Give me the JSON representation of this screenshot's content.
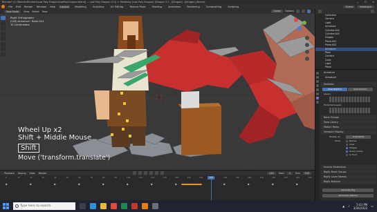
{
  "window": {
    "title": "Blender* [C:\\BlenderRenders\\Low Poly Dragon\\LowPolyDragon.blend]  —  Low Poly Dragon (3.1) > Modeling (Low Poly Dragon) (Dragon 3.1 - [Dragon] - [Dragon] (Blend)",
    "controls": [
      "—",
      "☐",
      "✕"
    ]
  },
  "menubar": {
    "menus": [
      "File",
      "Edit",
      "Render",
      "Window",
      "Help"
    ],
    "workspaces": [
      "Layout",
      "Modeling",
      "Sculpting",
      "UV Editing",
      "Texture Paint",
      "Shading",
      "Animation",
      "Rendering",
      "Compositing",
      "Scripting"
    ],
    "active_workspace": "Layout",
    "scene": "Scene",
    "view_layer": "ViewLayer"
  },
  "viewport": {
    "mode": "Pose Mode",
    "header_items": [
      "View",
      "Select",
      "Pose"
    ],
    "right_items": [
      "Global",
      "Options"
    ],
    "info": {
      "view": "Right Orthographic",
      "object": "(143) Armature : Bone.014",
      "scale": "10 Centimeters"
    },
    "overlay": {
      "line1": "Wheel Up x2",
      "line2": "Shift + Middle Mouse",
      "key": "Shift",
      "operator": "Move ('transform.translate')"
    }
  },
  "outliner": {
    "items": [
      {
        "label": "Collection",
        "selected": false
      },
      {
        "label": "Camera",
        "selected": false
      },
      {
        "label": "Light",
        "selected": false
      },
      {
        "label": "Armature",
        "selected": false
      },
      {
        "label": "Cylinder.004",
        "selected": false
      },
      {
        "label": "Cylinder.005",
        "selected": false
      },
      {
        "label": "Dragon",
        "selected": false
      },
      {
        "label": "Plane.001",
        "selected": false
      },
      {
        "label": "Plane.002",
        "selected": false
      },
      {
        "label": "Armature",
        "selected": true
      },
      {
        "label": "Pose",
        "selected": false
      },
      {
        "label": "Camera",
        "selected": false
      },
      {
        "label": "Cube",
        "selected": false
      },
      {
        "label": "Light",
        "selected": false
      },
      {
        "label": "Plane",
        "selected": false
      },
      {
        "label": "Rocks",
        "selected": false
      }
    ]
  },
  "properties": {
    "object_name": "Armature",
    "data_name": "Armature",
    "skeleton_header": "Skeleton",
    "pose_position": "Pose Position",
    "rest_position": "Rest Position",
    "layers_label": "Layers",
    "protected_label": "Protected Layers",
    "sections": [
      "Bone Groups",
      "Pose Library",
      "Motion Paths",
      "Viewport Display"
    ],
    "display_as_label": "Display As",
    "display_as_value": "Octahedral",
    "show_label": "Show",
    "checks": [
      {
        "label": "Names",
        "on": false
      },
      {
        "label": "Axes",
        "on": false
      },
      {
        "label": "Shapes",
        "on": true
      },
      {
        "label": "Group Colors",
        "on": true
      },
      {
        "label": "In Front",
        "on": false
      }
    ],
    "lower_sections": [
      "Inverse Kinematics",
      "Rigify Bone Groups",
      "Rigify Layer Names",
      "Rigify Buttons"
    ],
    "generate_label": "Generate Rig",
    "advanced_label": "Advanced Options"
  },
  "timeline": {
    "items": [
      "Playback",
      "Keying",
      "View",
      "Marker"
    ],
    "current_frame": "143",
    "start_label": "Start",
    "start_frame": "1",
    "end_label": "End",
    "end_frame": "250",
    "ruler": [
      "0",
      "10",
      "20",
      "30",
      "40",
      "50",
      "60",
      "70",
      "80",
      "90",
      "100",
      "110",
      "120",
      "130",
      "140",
      "150",
      "160",
      "170",
      "180",
      "190",
      "200",
      "210",
      "220",
      "230",
      "240",
      "250"
    ]
  },
  "taskbar": {
    "search_placeholder": "Type here to search",
    "time": "5:43 PM",
    "date": "3/26/2022"
  },
  "colors": {
    "accent": "#4772b3",
    "dragon_red": "#c83030",
    "selected_row": "#334d80"
  }
}
